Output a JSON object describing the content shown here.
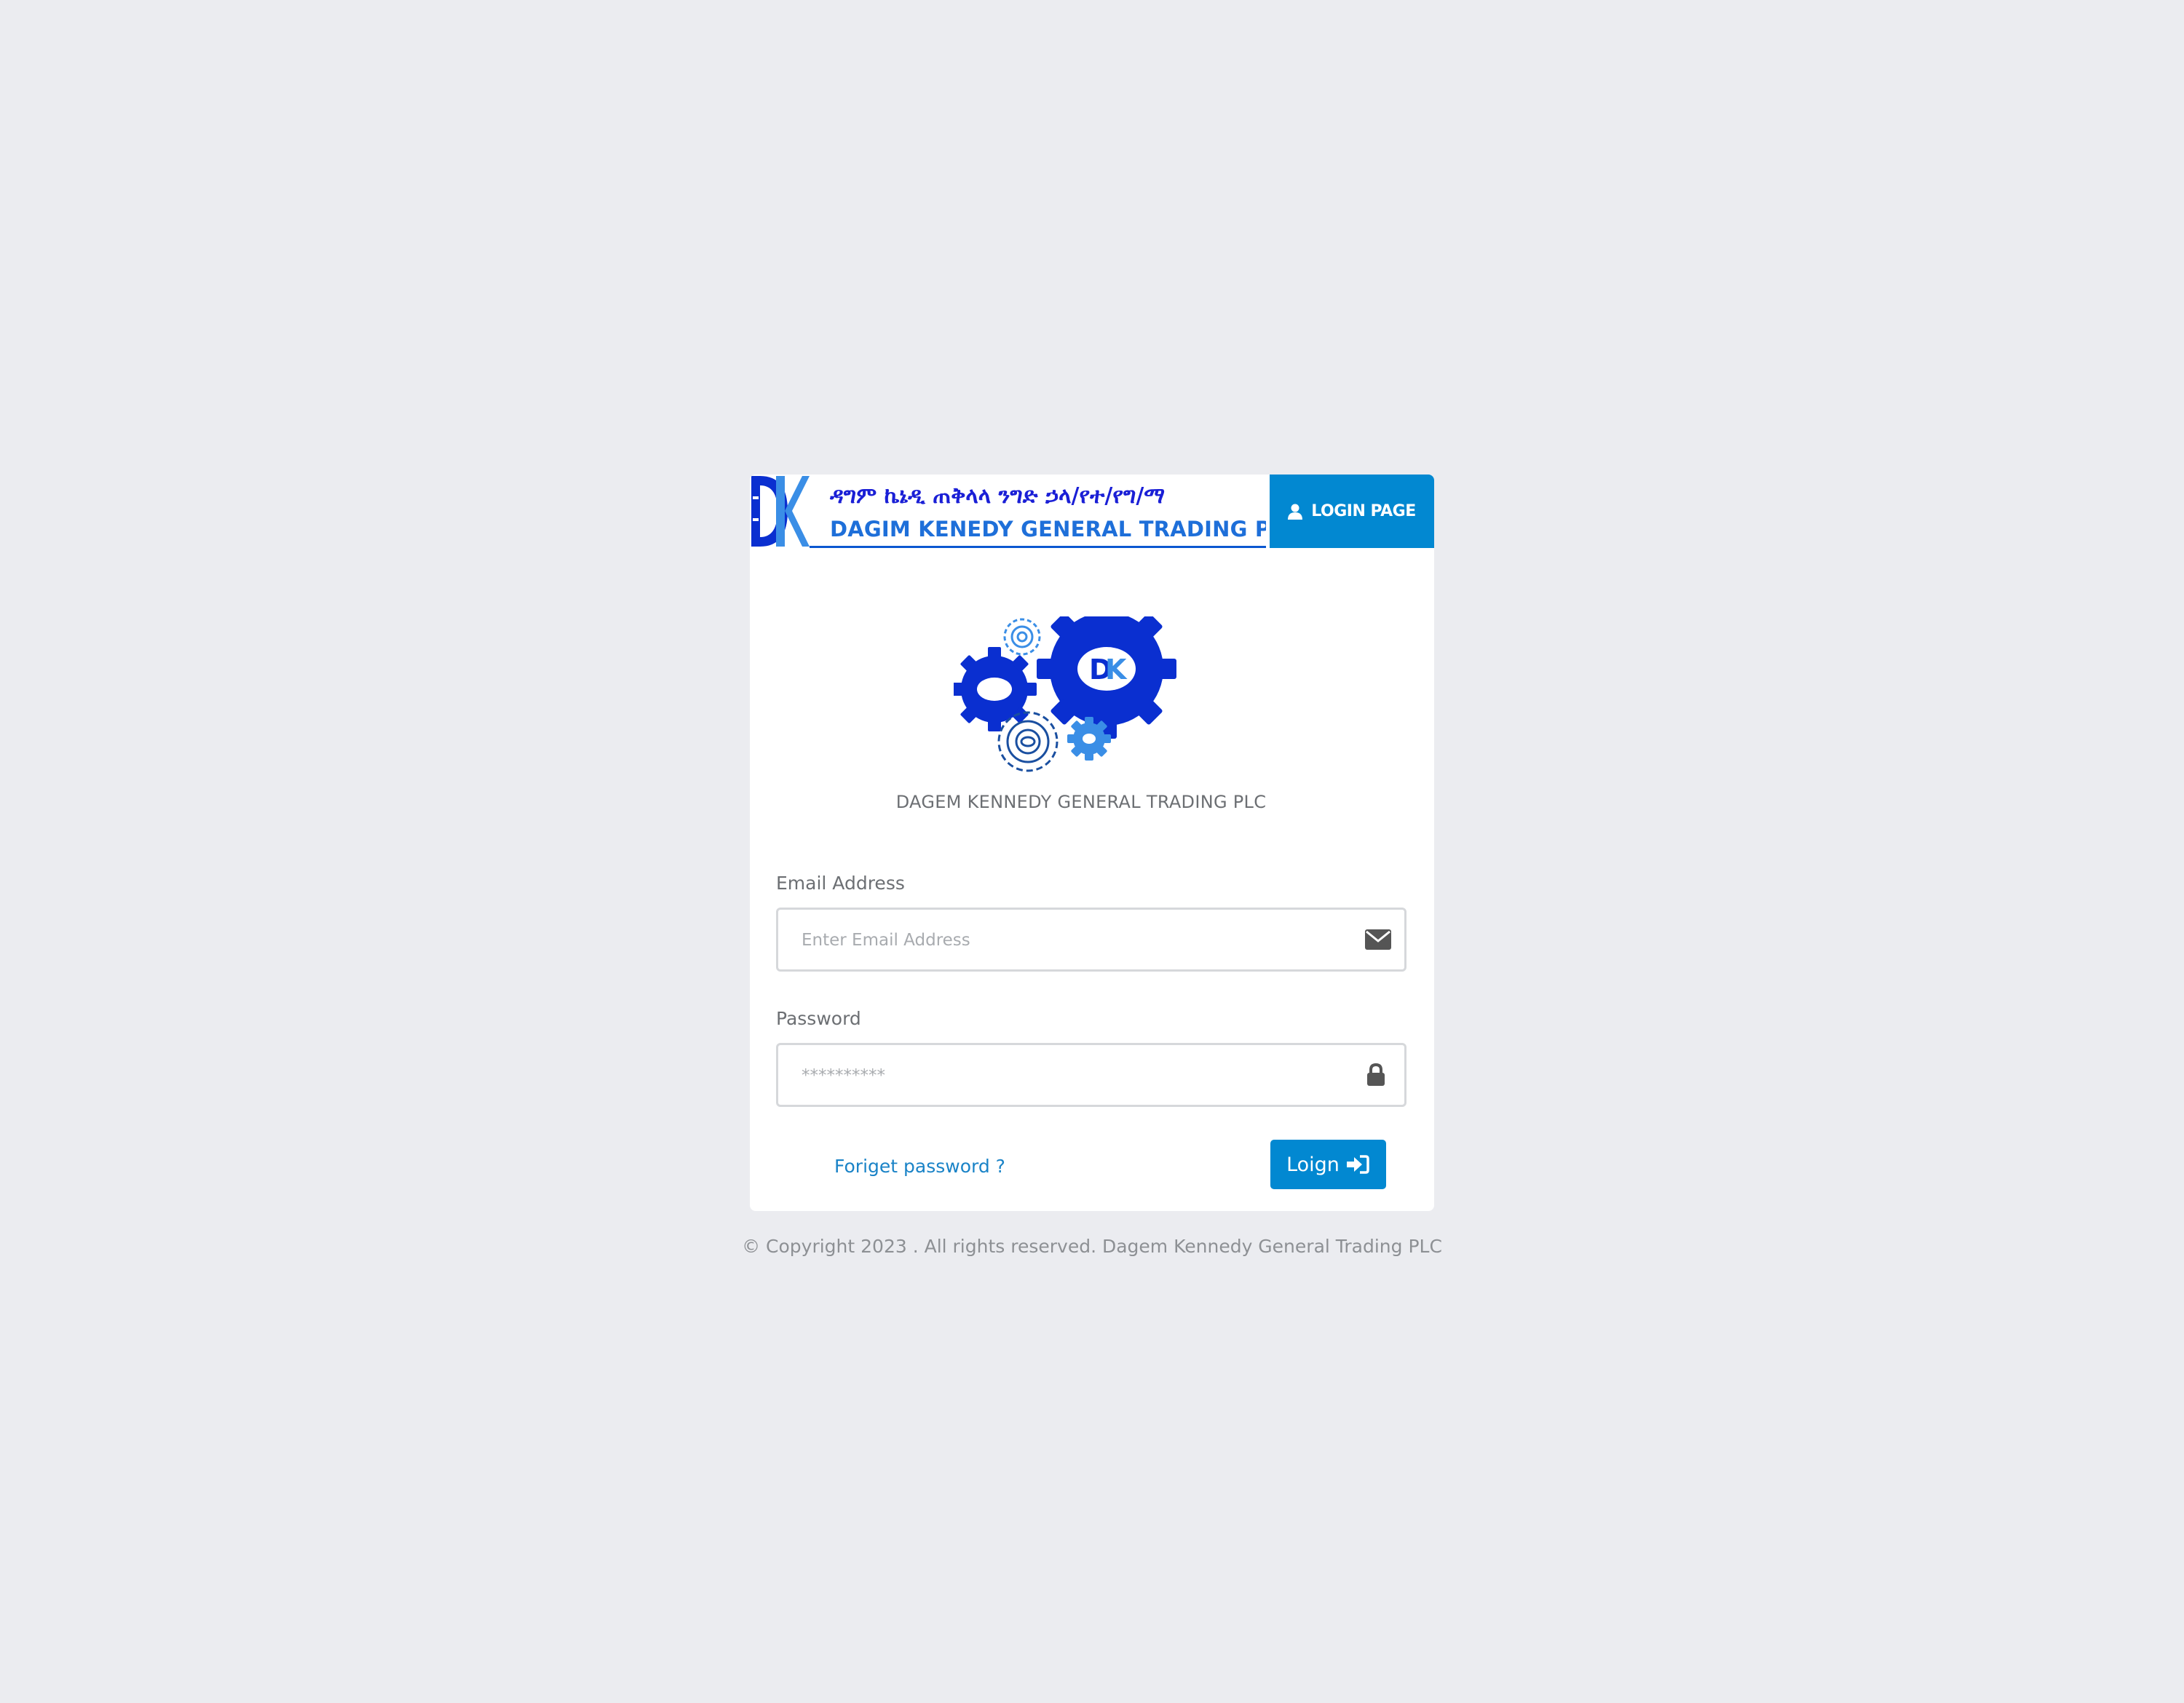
{
  "header": {
    "banner_amharic": "ዳግም ኬኔዲ ጠቅላላ ንግድ ኃላ/የተ/የግ/ማ",
    "banner_english": "DAGIM KENEDY GENERAL TRADING PLC",
    "banner_logo_icon": "dk-logo-icon",
    "login_tab_label": "LOGIN PAGE",
    "login_tab_icon": "user-icon"
  },
  "brand": {
    "logo_icon": "gears-dk-logo-icon",
    "company_name": "DAGEM KENNEDY GENERAL TRADING PLC"
  },
  "form": {
    "email": {
      "label": "Email Address",
      "value": "",
      "placeholder": "Enter Email Address",
      "icon": "envelope-icon"
    },
    "password": {
      "label": "Password",
      "value": "",
      "placeholder": "**********",
      "icon": "lock-icon"
    },
    "forgot_password_label": "Foriget password ?",
    "login_button_label": "Loign",
    "login_button_icon": "sign-in-icon"
  },
  "footer": {
    "copyright": "© Copyright 2023 . All rights reserved. Dagem Kennedy General Trading PLC"
  },
  "colors": {
    "background": "#ebecf0",
    "primary": "#0288d1",
    "link": "#1a83c7",
    "logo_blue": "#0a2fd0",
    "logo_light_blue": "#3a95e6"
  }
}
